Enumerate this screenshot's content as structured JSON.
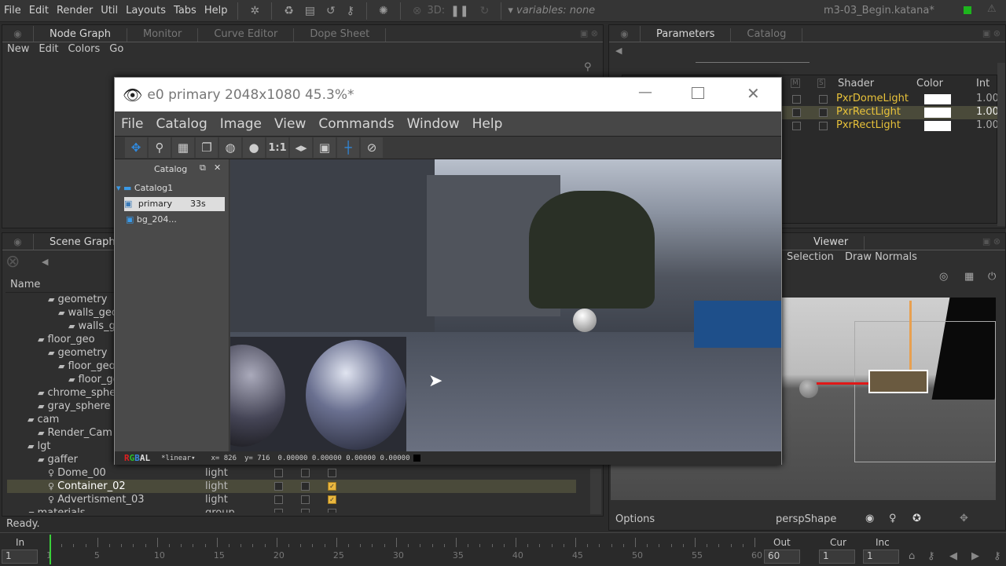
{
  "menubar": {
    "items": [
      "File",
      "Edit",
      "Render",
      "Util",
      "Layouts",
      "Tabs",
      "Help"
    ],
    "threed_label": "3D:",
    "variables": "variables: none",
    "project": "m3-03_Begin.katana*",
    "status_color": "#1db51d"
  },
  "node_graph": {
    "tabs": [
      "Node Graph",
      "Monitor",
      "Curve Editor",
      "Dope Sheet"
    ],
    "menu": [
      "New",
      "Edit",
      "Colors",
      "Go"
    ]
  },
  "parameters": {
    "tabs": [
      "Parameters",
      "Catalog"
    ],
    "columns": [
      "M",
      "S",
      "Shader",
      "Color",
      "Int"
    ],
    "rows": [
      {
        "shader": "PxrDomeLight",
        "intensity": "1.00"
      },
      {
        "shader": "PxrRectLight",
        "intensity": "1.00"
      },
      {
        "shader": "PxrRectLight",
        "intensity": "1.00"
      }
    ],
    "shader_color": "#e8c23a"
  },
  "scene_graph": {
    "tab": "Scene Graph",
    "column_name": "Name",
    "rows": [
      {
        "name": "geometry",
        "type": "",
        "indent": 4
      },
      {
        "name": "walls_geo",
        "type": "",
        "indent": 5
      },
      {
        "name": "walls_geo",
        "type": "",
        "indent": 6
      },
      {
        "name": "floor_geo",
        "type": "",
        "indent": 3
      },
      {
        "name": "geometry",
        "type": "",
        "indent": 4
      },
      {
        "name": "floor_geo",
        "type": "",
        "indent": 5
      },
      {
        "name": "floor_geo",
        "type": "",
        "indent": 6
      },
      {
        "name": "chrome_sphere",
        "type": "",
        "indent": 3
      },
      {
        "name": "gray_sphere",
        "type": "",
        "indent": 3
      },
      {
        "name": "cam",
        "type": "",
        "indent": 2
      },
      {
        "name": "Render_Cam",
        "type": "",
        "indent": 3
      },
      {
        "name": "lgt",
        "type": "",
        "indent": 2
      },
      {
        "name": "gaffer",
        "type": "",
        "indent": 3
      },
      {
        "name": "Dome_00",
        "type": "light",
        "indent": 4,
        "checked": false
      },
      {
        "name": "Container_02",
        "type": "light",
        "indent": 4,
        "checked": true,
        "selected": true
      },
      {
        "name": "Advertisment_03",
        "type": "light",
        "indent": 4,
        "checked": true
      },
      {
        "name": "materials",
        "type": "group",
        "indent": 2,
        "checked": false
      }
    ]
  },
  "status": "Ready.",
  "viewer": {
    "tabs": [
      "Viewer"
    ],
    "menu": [
      "Selection",
      "Draw Normals"
    ],
    "camera": "perspShape",
    "options": "Options"
  },
  "timeline": {
    "in_label": "In",
    "in": "1",
    "out_label": "Out",
    "out": "60",
    "cur_label": "Cur",
    "cur": "1",
    "inc_label": "Inc",
    "inc": "1",
    "ticks": [
      "1",
      "5",
      "10",
      "15",
      "20",
      "25",
      "30",
      "35",
      "40",
      "45",
      "50",
      "55",
      "60"
    ]
  },
  "it_window": {
    "title": "e0 primary 2048x1080 45.3%*",
    "menu": [
      "File",
      "Catalog",
      "Image",
      "View",
      "Commands",
      "Window",
      "Help"
    ],
    "toolbar_ratio": "1:1",
    "catalog": {
      "title": "Catalog",
      "root": "Catalog1",
      "items": [
        {
          "name": "primary",
          "time": "33s"
        },
        {
          "name": "bg_204..."
        }
      ]
    },
    "status": {
      "channels": [
        "R",
        "G",
        "B",
        "A",
        "L"
      ],
      "lut": "*linear",
      "x": "x= 826",
      "y": "y= 716",
      "values": "0.00000 0.00000 0.00000 0.00000"
    }
  }
}
